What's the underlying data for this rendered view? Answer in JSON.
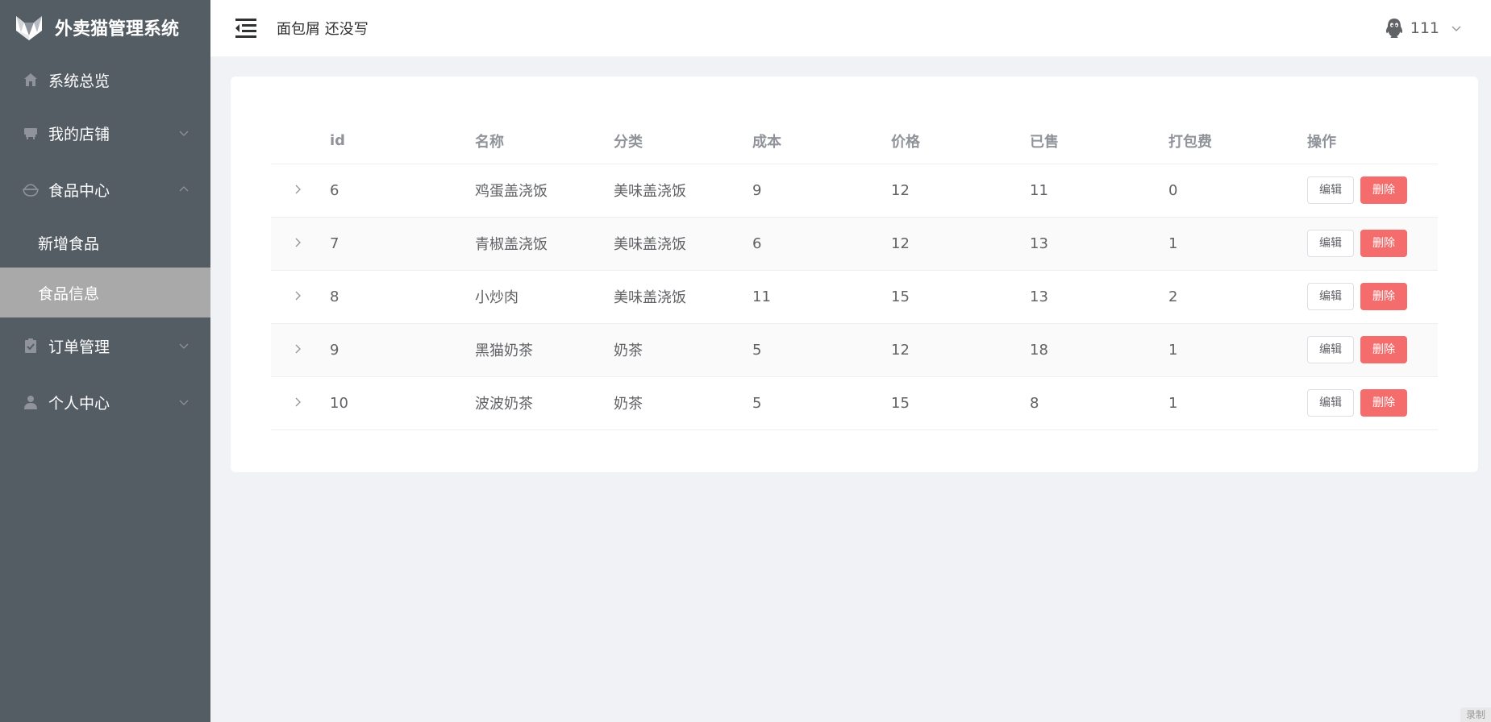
{
  "app": {
    "title": "外卖猫管理系统"
  },
  "sidebar": {
    "items": [
      {
        "label": "系统总览",
        "icon": "home-icon",
        "has_chevron": false
      },
      {
        "label": "我的店铺",
        "icon": "store-icon",
        "chevron": "down"
      },
      {
        "label": "食品中心",
        "icon": "food-bowl-icon",
        "chevron": "up"
      },
      {
        "label": "订单管理",
        "icon": "clipboard-icon",
        "chevron": "down"
      },
      {
        "label": "个人中心",
        "icon": "user-icon",
        "chevron": "down"
      }
    ],
    "sub_items": [
      {
        "label": "新增食品",
        "active": false
      },
      {
        "label": "食品信息",
        "active": true
      }
    ]
  },
  "header": {
    "breadcrumb": "面包屑 还没写",
    "user_name": "111"
  },
  "table": {
    "headers": [
      "id",
      "名称",
      "分类",
      "成本",
      "价格",
      "已售",
      "打包费",
      "操作"
    ],
    "rows": [
      {
        "id": "6",
        "name": "鸡蛋盖浇饭",
        "category": "美味盖浇饭",
        "cost": "9",
        "price": "12",
        "sold": "11",
        "packing": "0"
      },
      {
        "id": "7",
        "name": "青椒盖浇饭",
        "category": "美味盖浇饭",
        "cost": "6",
        "price": "12",
        "sold": "13",
        "packing": "1"
      },
      {
        "id": "8",
        "name": "小炒肉",
        "category": "美味盖浇饭",
        "cost": "11",
        "price": "15",
        "sold": "13",
        "packing": "2"
      },
      {
        "id": "9",
        "name": "黑猫奶茶",
        "category": "奶茶",
        "cost": "5",
        "price": "12",
        "sold": "18",
        "packing": "1"
      },
      {
        "id": "10",
        "name": "波波奶茶",
        "category": "奶茶",
        "cost": "5",
        "price": "15",
        "sold": "8",
        "packing": "1"
      }
    ],
    "edit_label": "编辑",
    "delete_label": "删除"
  },
  "watermark": "录制",
  "colors": {
    "sidebar_bg": "#545c64",
    "active_sub_bg": "#a9a9a9",
    "danger": "#f56c6c",
    "page_bg": "#f0f2f5"
  }
}
